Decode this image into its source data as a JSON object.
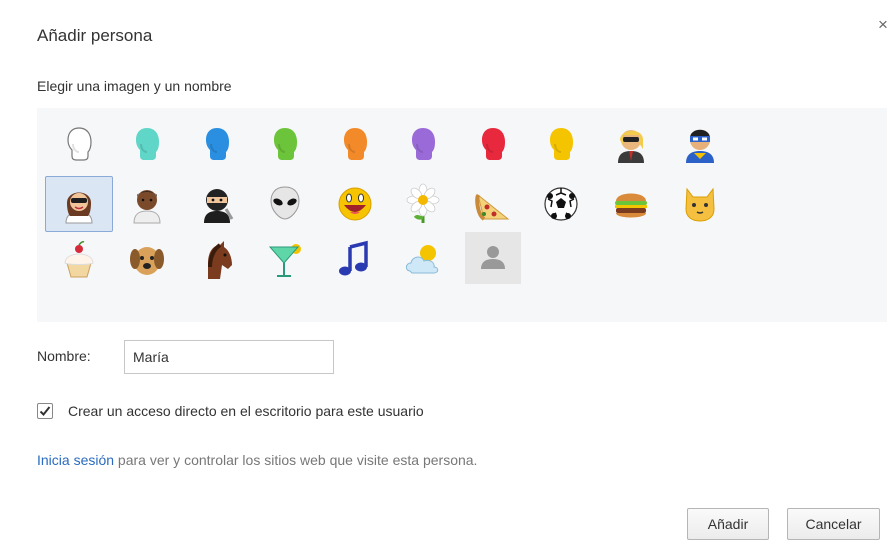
{
  "dialog": {
    "title": "Añadir persona",
    "close_glyph": "×",
    "subtitle": "Elegir una imagen y un nombre"
  },
  "avatars": [
    {
      "name": "avatar-generic-white",
      "icon": "head-silhouette-white",
      "color": "#ffffff"
    },
    {
      "name": "avatar-generic-cyan",
      "icon": "head-silhouette-cyan",
      "color": "#5fd6c8"
    },
    {
      "name": "avatar-generic-blue",
      "icon": "head-silhouette-blue",
      "color": "#2a8fe0"
    },
    {
      "name": "avatar-generic-green",
      "icon": "head-silhouette-green",
      "color": "#6cc43a"
    },
    {
      "name": "avatar-generic-orange",
      "icon": "head-silhouette-orange",
      "color": "#f38a2a"
    },
    {
      "name": "avatar-generic-purple",
      "icon": "head-silhouette-purple",
      "color": "#9a6ad8"
    },
    {
      "name": "avatar-generic-red",
      "icon": "head-silhouette-red",
      "color": "#e8283c"
    },
    {
      "name": "avatar-generic-yellow",
      "icon": "head-silhouette-yellow",
      "color": "#f5c400"
    },
    {
      "name": "avatar-businessman",
      "icon": "businessman-icon"
    },
    {
      "name": "avatar-superhero",
      "icon": "superhero-icon"
    },
    {
      "name": "avatar-woman",
      "icon": "woman-icon",
      "selected": true
    },
    {
      "name": "avatar-man",
      "icon": "man-icon"
    },
    {
      "name": "avatar-ninja",
      "icon": "ninja-icon"
    },
    {
      "name": "avatar-alien",
      "icon": "alien-icon"
    },
    {
      "name": "avatar-smiley",
      "icon": "smiley-icon"
    },
    {
      "name": "avatar-flower",
      "icon": "flower-icon"
    },
    {
      "name": "avatar-pizza",
      "icon": "pizza-icon"
    },
    {
      "name": "avatar-soccer-ball",
      "icon": "soccer-ball-icon"
    },
    {
      "name": "avatar-hamburger",
      "icon": "hamburger-icon"
    },
    {
      "name": "avatar-cat",
      "icon": "cat-icon"
    },
    {
      "name": "avatar-cupcake",
      "icon": "cupcake-icon"
    },
    {
      "name": "avatar-dog",
      "icon": "dog-icon"
    },
    {
      "name": "avatar-horse",
      "icon": "horse-icon"
    },
    {
      "name": "avatar-cocktail",
      "icon": "cocktail-icon"
    },
    {
      "name": "avatar-music-note",
      "icon": "music-note-icon"
    },
    {
      "name": "avatar-weather",
      "icon": "sun-cloud-icon"
    },
    {
      "name": "avatar-placeholder",
      "icon": "placeholder-person-icon"
    }
  ],
  "form": {
    "name_label": "Nombre:",
    "name_value": "María",
    "shortcut_checked": true,
    "shortcut_label": "Crear un acceso directo en el escritorio para este usuario",
    "signin_link": "Inicia sesión",
    "signin_text": " para ver y controlar los sitios web que visite esta persona."
  },
  "buttons": {
    "add": "Añadir",
    "cancel": "Cancelar"
  },
  "colors": {
    "link": "#2a6bbf",
    "selection_bg": "#dbe6f5",
    "selection_border": "#8aa9d6"
  }
}
